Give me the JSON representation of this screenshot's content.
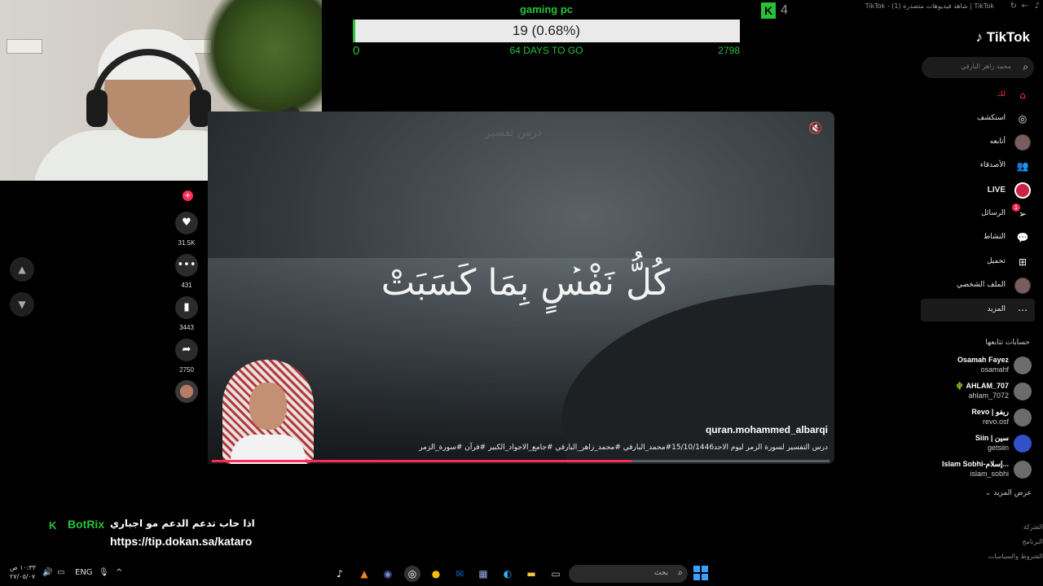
{
  "browser": {
    "title": "TikTok - شاهد فيديوهات متصدرة (1) | TikTok",
    "back": "←",
    "refresh": "↻"
  },
  "goal": {
    "label": "gaming pc",
    "value_text": "19 (0.68%)",
    "progress": 0.0068,
    "min": "0",
    "days": "64 DAYS TO GO",
    "max": "2798"
  },
  "kick_viewers": {
    "logo": "K",
    "count": "4"
  },
  "video": {
    "watermark": "درس تفسير",
    "verse": "كُلُّ نَفْسٍ بِمَا كَسَبَتْ",
    "author": "quran.mohammed_albarqi",
    "caption": "درس التفسير لسورة الزمر  ليوم الاحد15/10/1446#محمد_البارقي #محمد_زاهر_البارقي #جامع_الاجواد_الكبير #قرآن #سورة_الزمر",
    "progress": 0.68,
    "mute_icon": "🔇"
  },
  "actions": {
    "plus": "+",
    "likes": "31.5K",
    "comments": "431",
    "saves": "3443",
    "shares": "2750"
  },
  "nav": {
    "up": "▲",
    "down": "▼"
  },
  "tiktok": {
    "logo": "TikTok",
    "search_placeholder": "محمد زاهر البارقي",
    "menu": [
      {
        "label": "لك",
        "icon": "⌂"
      },
      {
        "label": "استكشف",
        "icon": "◎"
      },
      {
        "label": "أتابعه",
        "icon": ""
      },
      {
        "label": "الأصدقاء",
        "icon": "👥"
      },
      {
        "label": "LIVE",
        "icon": ""
      },
      {
        "label": "الرسائل",
        "icon": "➢",
        "badge": "1"
      },
      {
        "label": "النشاط",
        "icon": "💬"
      },
      {
        "label": "تحميل",
        "icon": "⊞"
      },
      {
        "label": "الملف الشخصي",
        "icon": ""
      },
      {
        "label": "المزيد",
        "icon": "⋯"
      }
    ],
    "following_title": "حسابات تتابعها",
    "accounts": [
      {
        "name": "Osamah Fayez",
        "user": "osamahf"
      },
      {
        "name": "🌵 AHLAM_707",
        "user": "ahlam_7072"
      },
      {
        "name": "Revo | ريفو",
        "user": "revo.osf"
      },
      {
        "name": "Siin | سين",
        "user": "getsiin"
      },
      {
        "name": "Islam Sobhi-إسلام...",
        "user": "islam_sobhi"
      }
    ],
    "show_more": "عرض المزيد",
    "footer": [
      "الشركة",
      "البرنامج",
      "الشروط والسياسات"
    ]
  },
  "botrix": {
    "k": "K",
    "name": "BotRix",
    "message": "اذا حاب تدعم الدعم مو اجباري",
    "url": "https://tip.dokan.sa/kataro"
  },
  "taskbar": {
    "time": "١٠:٣٣ ص",
    "date": "٢٧/٠٥/٠٧",
    "lang": "ENG",
    "search_placeholder": "بحث",
    "tray_up": "^"
  },
  "colors": {
    "kick_green": "#27c13a",
    "tiktok_red": "#fe2c55"
  }
}
